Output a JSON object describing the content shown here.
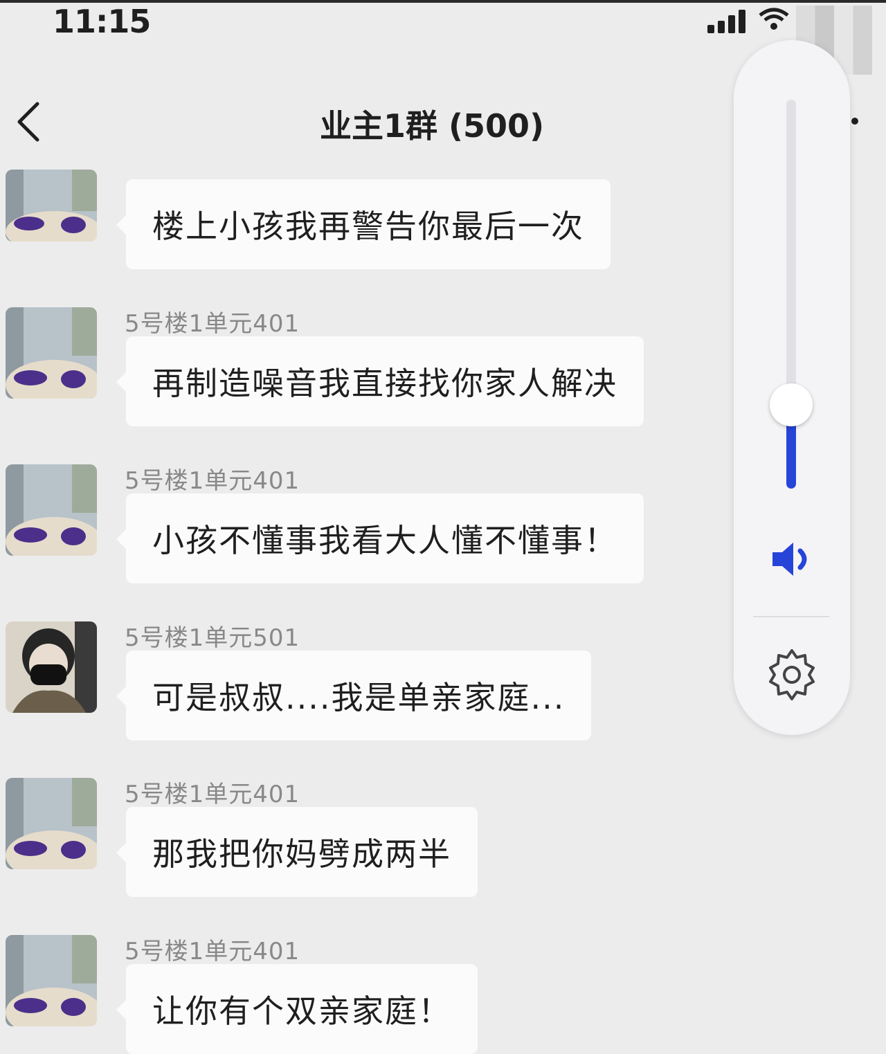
{
  "status_bar": {
    "time": "11:15"
  },
  "header": {
    "title": "业主1群 (500)"
  },
  "messages": [
    {
      "sender": "",
      "text": "楼上小孩我再警告你最后一次",
      "avatar": "street-avatar"
    },
    {
      "sender": "5号楼1单元401",
      "text": "再制造噪音我直接找你家人解决",
      "avatar": "street-avatar"
    },
    {
      "sender": "5号楼1单元401",
      "text": "小孩不懂事我看大人懂不懂事！",
      "avatar": "street-avatar"
    },
    {
      "sender": "5号楼1单元501",
      "text": "可是叔叔....我是单亲家庭...",
      "avatar": "masked-person-avatar"
    },
    {
      "sender": "5号楼1单元401",
      "text": "那我把你妈劈成两半",
      "avatar": "street-avatar"
    },
    {
      "sender": "5号楼1单元401",
      "text": "让你有个双亲家庭！",
      "avatar": "street-avatar"
    }
  ],
  "volume_panel": {
    "level": 0.22,
    "accent_color": "#2744d8",
    "icons": [
      "speaker-icon",
      "gear-icon"
    ]
  }
}
